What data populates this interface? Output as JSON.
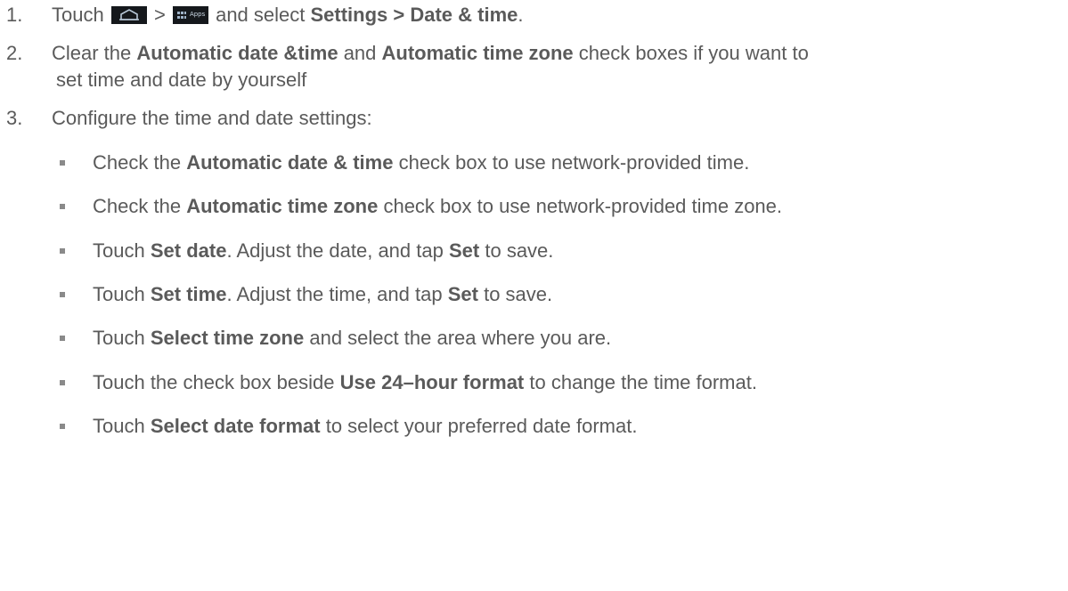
{
  "steps": [
    {
      "number": "1.",
      "parts": {
        "touch": "Touch",
        "gt": ">",
        "and_select": "and select",
        "bold": "Settings > Date & time",
        "end": "."
      },
      "icons": {
        "home": "home-icon",
        "apps": "apps-icon",
        "apps_label": "Apps"
      }
    },
    {
      "number": "2.",
      "parts": {
        "t1": "Clear the",
        "b1": "Automatic date &time",
        "t2": "and",
        "b2": "Automatic time zone",
        "t3": "check boxes if you want to",
        "cont": "set time and date by yourself"
      }
    },
    {
      "number": "3.",
      "text": "Configure the time and date settings:"
    }
  ],
  "bullets": [
    {
      "t1": "Check the",
      "b1": "Automatic date & time",
      "t2": "check box to use network-provided time."
    },
    {
      "t1": "Check the",
      "b1": "Automatic time zone",
      "t2": "check box to use network-provided time zone."
    },
    {
      "t1": "Touch",
      "b1": "Set date",
      "t2": ". Adjust the date, and tap",
      "b2": "Set",
      "t3": "to save."
    },
    {
      "t1": "Touch",
      "b1": "Set time",
      "t2": ". Adjust the time, and tap",
      "b2": "Set",
      "t3": "to save."
    },
    {
      "t1": "Touch",
      "b1": "Select time zone",
      "t2": "and select the area where you are."
    },
    {
      "t1": "Touch the check box beside",
      "b1": "Use 24–hour format",
      "t2": "to change the time format."
    },
    {
      "t1": "Touch",
      "b1": "Select date format",
      "t2": "to select your preferred date format."
    }
  ],
  "colors": {
    "text": "#5a5a5a",
    "icon_bg": "#15181c"
  }
}
